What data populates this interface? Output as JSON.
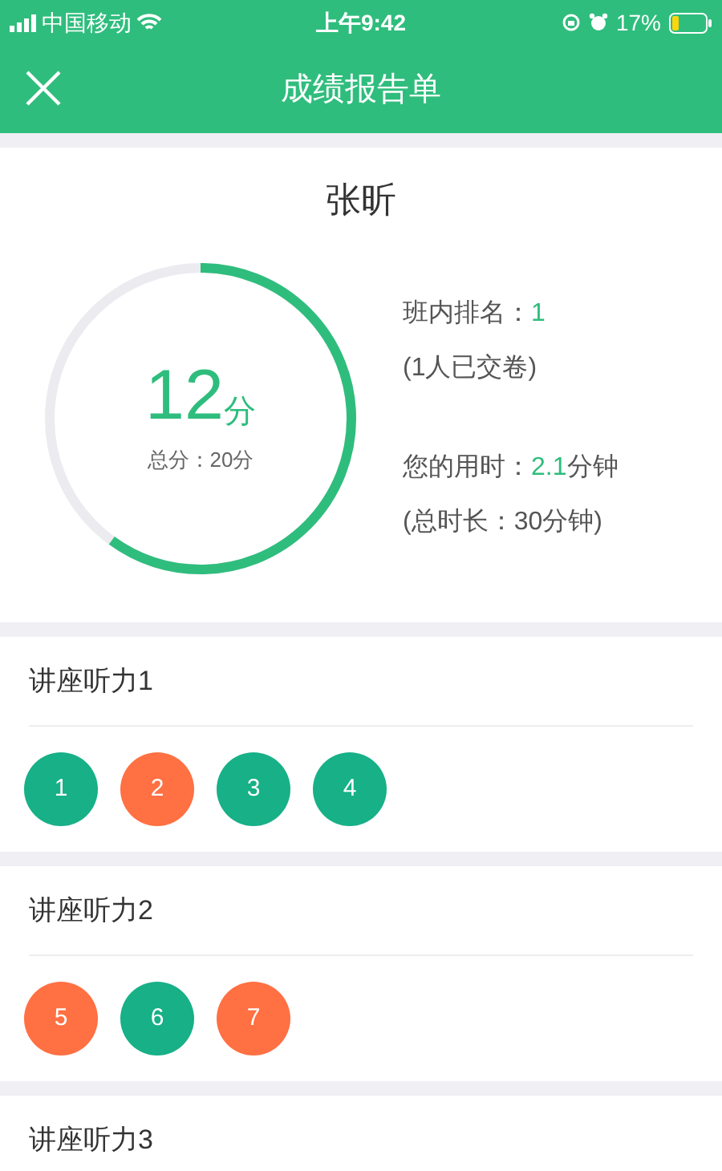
{
  "status_bar": {
    "carrier": "中国移动",
    "time": "上午9:42",
    "battery_text": "17%"
  },
  "header": {
    "title": "成绩报告单"
  },
  "report": {
    "name": "张昕",
    "score": "12",
    "score_unit": "分",
    "total": "总分：20分",
    "rank_label": "班内排名：",
    "rank_value": "1",
    "submitted": "(1人已交卷)",
    "time_label": "您的用时：",
    "time_value": "2.1",
    "time_unit": "分钟",
    "duration": "(总时长：30分钟)"
  },
  "sections": [
    {
      "title": "讲座听力1",
      "questions": [
        {
          "number": "1",
          "correct": true
        },
        {
          "number": "2",
          "correct": false
        },
        {
          "number": "3",
          "correct": true
        },
        {
          "number": "4",
          "correct": true
        }
      ]
    },
    {
      "title": "讲座听力2",
      "questions": [
        {
          "number": "5",
          "correct": false
        },
        {
          "number": "6",
          "correct": true
        },
        {
          "number": "7",
          "correct": false
        }
      ]
    },
    {
      "title": "讲座听力3"
    }
  ]
}
